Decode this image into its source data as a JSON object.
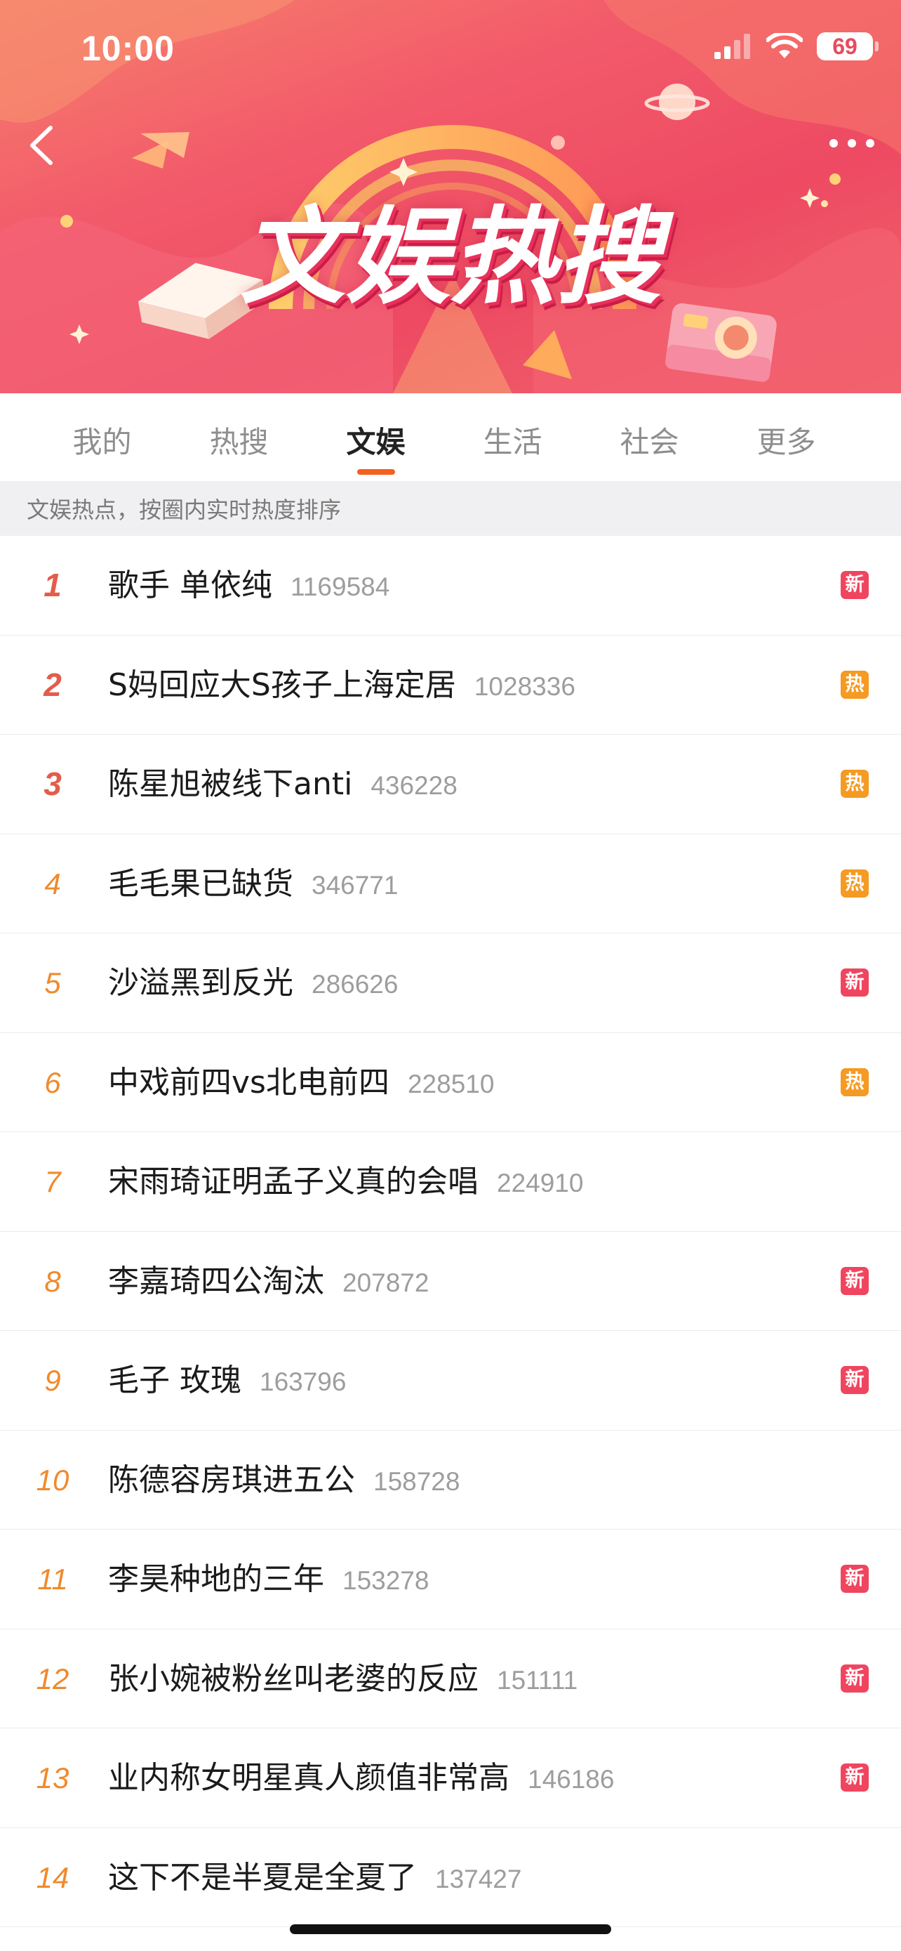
{
  "status_bar": {
    "time": "10:00",
    "battery": "69"
  },
  "banner": {
    "title": "文娱热搜",
    "back_icon": "chevron-left-icon",
    "more_icon": "ellipsis-icon"
  },
  "tabs": [
    {
      "label": "我的",
      "active": false
    },
    {
      "label": "热搜",
      "active": false
    },
    {
      "label": "文娱",
      "active": true
    },
    {
      "label": "生活",
      "active": false
    },
    {
      "label": "社会",
      "active": false
    },
    {
      "label": "更多",
      "active": false
    }
  ],
  "subheader": "文娱热点，按圈内实时热度排序",
  "colors": {
    "accent": "#f2611f",
    "new_badge": "#f0455f",
    "hot_badge": "#f59a22",
    "rank": "#f08a2c",
    "top_rank": "#e45c4a"
  },
  "list": [
    {
      "rank": "1",
      "title": "歌手 单依纯",
      "count": "1169584",
      "badge": "新",
      "badge_type": "new"
    },
    {
      "rank": "2",
      "title": "S妈回应大S孩子上海定居",
      "count": "1028336",
      "badge": "热",
      "badge_type": "hot"
    },
    {
      "rank": "3",
      "title": "陈星旭被线下anti",
      "count": "436228",
      "badge": "热",
      "badge_type": "hot"
    },
    {
      "rank": "4",
      "title": "毛毛果已缺货",
      "count": "346771",
      "badge": "热",
      "badge_type": "hot"
    },
    {
      "rank": "5",
      "title": "沙溢黑到反光",
      "count": "286626",
      "badge": "新",
      "badge_type": "new"
    },
    {
      "rank": "6",
      "title": "中戏前四vs北电前四",
      "count": "228510",
      "badge": "热",
      "badge_type": "hot"
    },
    {
      "rank": "7",
      "title": "宋雨琦证明孟子义真的会唱",
      "count": "224910",
      "badge": "",
      "badge_type": ""
    },
    {
      "rank": "8",
      "title": "李嘉琦四公淘汰",
      "count": "207872",
      "badge": "新",
      "badge_type": "new"
    },
    {
      "rank": "9",
      "title": "毛子 玫瑰",
      "count": "163796",
      "badge": "新",
      "badge_type": "new"
    },
    {
      "rank": "10",
      "title": "陈德容房琪进五公",
      "count": "158728",
      "badge": "",
      "badge_type": ""
    },
    {
      "rank": "11",
      "title": "李昊种地的三年",
      "count": "153278",
      "badge": "新",
      "badge_type": "new"
    },
    {
      "rank": "12",
      "title": "张小婉被粉丝叫老婆的反应",
      "count": "151111",
      "badge": "新",
      "badge_type": "new"
    },
    {
      "rank": "13",
      "title": "业内称女明星真人颜值非常高",
      "count": "146186",
      "badge": "新",
      "badge_type": "new"
    },
    {
      "rank": "14",
      "title": "这下不是半夏是全夏了",
      "count": "137427",
      "badge": "",
      "badge_type": ""
    }
  ]
}
